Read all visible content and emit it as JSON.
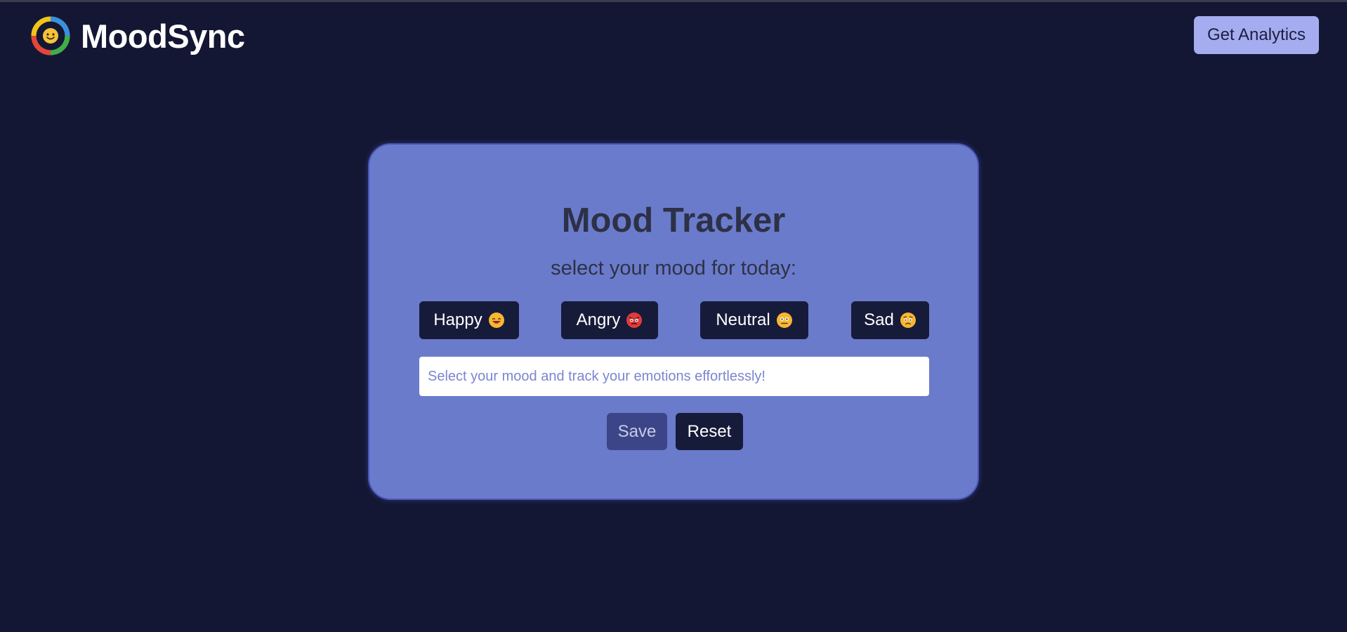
{
  "header": {
    "brand_name": "MoodSync",
    "logo_icon": "mood-ring-logo-icon",
    "analytics_label": "Get Analytics"
  },
  "card": {
    "title": "Mood Tracker",
    "subtitle": "select your mood for today:",
    "moods": [
      {
        "label": "Happy",
        "icon": "grinning-face-icon"
      },
      {
        "label": "Angry",
        "icon": "angry-face-icon"
      },
      {
        "label": "Neutral",
        "icon": "neutral-face-icon"
      },
      {
        "label": "Sad",
        "icon": "sad-face-icon"
      }
    ],
    "input_placeholder": "Select your mood and track your emotions effortlessly!",
    "input_value": "",
    "save_label": "Save",
    "reset_label": "Reset"
  },
  "colors": {
    "background": "#131733",
    "card": "#6b7bcb",
    "button_dark": "#171b3a",
    "analytics_button": "#a6acf0",
    "save_button": "#3c4588"
  }
}
